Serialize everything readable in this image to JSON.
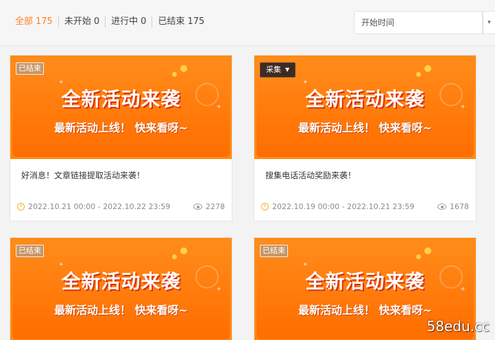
{
  "filters": [
    {
      "label": "全部",
      "count": "175",
      "active": true
    },
    {
      "label": "未开始",
      "count": "0",
      "active": false
    },
    {
      "label": "进行中",
      "count": "0",
      "active": false
    },
    {
      "label": "已结束",
      "count": "175",
      "active": false
    }
  ],
  "sort_select": {
    "value": "开始时间"
  },
  "banner": {
    "title": "全新活动来袭",
    "subtitle": "最新活动上线！ 快来看呀~"
  },
  "cards": [
    {
      "badge": "已结束",
      "title": "好消息！文章链接提取活动来袭！",
      "date_range": "2022.10.21 00:00 - 2022.10.22 23:59",
      "views": "2278"
    },
    {
      "badge": "采集",
      "title": "搜集电话活动奖励来袭！",
      "date_range": "2022.10.19 00:00 - 2022.10.21 23:59",
      "views": "1678"
    },
    {
      "badge": "已结束"
    },
    {
      "badge": "已结束"
    }
  ],
  "colors": {
    "accent": "#ff7f1e",
    "banner": "#ff7d0a",
    "clock_icon": "#f0b323"
  },
  "watermark": "58edu.cc"
}
